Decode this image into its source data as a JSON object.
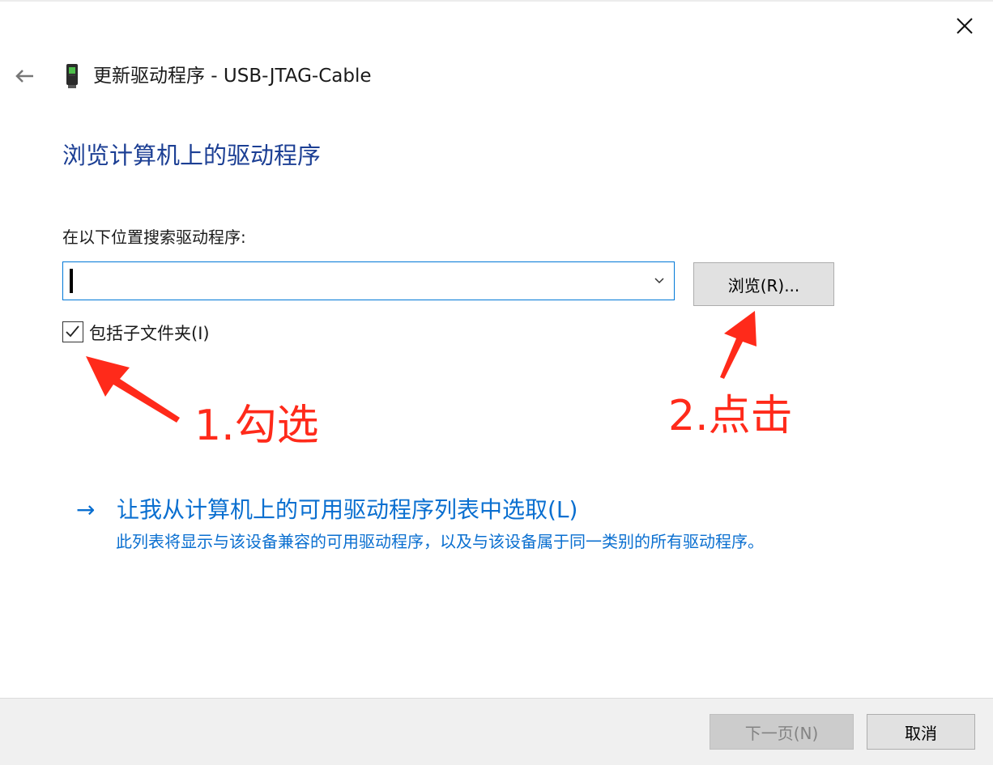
{
  "window": {
    "title": "更新驱动程序 - USB-JTAG-Cable"
  },
  "page": {
    "heading": "浏览计算机上的驱动程序",
    "search_label": "在以下位置搜索驱动程序:",
    "path_value": "",
    "browse_label": "浏览(R)...",
    "include_subfolders_label": "包括子文件夹(I)",
    "include_subfolders_checked": true
  },
  "pick_option": {
    "arrow": "→",
    "title": "让我从计算机上的可用驱动程序列表中选取(L)",
    "description": "此列表将显示与该设备兼容的可用驱动程序，以及与该设备属于同一类别的所有驱动程序。"
  },
  "annotations": {
    "step1": "1.勾选",
    "step2": "2.点击",
    "color": "#ff2a1a"
  },
  "footer": {
    "next_label": "下一页(N)",
    "next_enabled": false,
    "cancel_label": "取消"
  },
  "icons": {
    "close": "close-icon",
    "back": "back-arrow-icon",
    "device": "usb-device-icon",
    "dropdown": "chevron-down-icon",
    "check": "checkmark-icon"
  },
  "colors": {
    "heading": "#1c3f94",
    "link": "#0a6fd0",
    "focus_border": "#0078d7"
  }
}
